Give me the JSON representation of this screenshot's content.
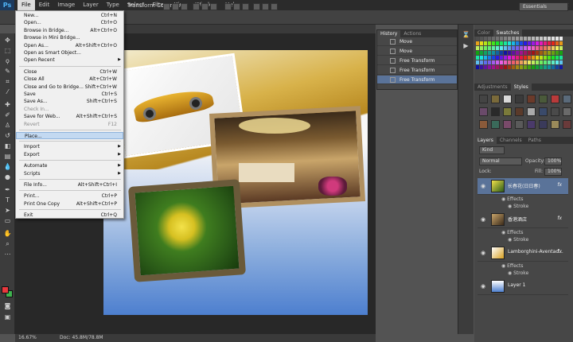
{
  "app": {
    "logo": "Ps"
  },
  "menubar": [
    "File",
    "Edit",
    "Image",
    "Layer",
    "Type",
    "Select",
    "Filter",
    "View",
    "Window",
    "Help"
  ],
  "window_controls": [
    "–",
    "□",
    "✕"
  ],
  "options_bar": {
    "show_transform_controls": "Transform Controls",
    "workspace": "Essentials"
  },
  "file_menu": [
    {
      "label": "New...",
      "shortcut": "Ctrl+N"
    },
    {
      "label": "Open...",
      "shortcut": "Ctrl+O"
    },
    {
      "label": "Browse in Bridge...",
      "shortcut": "Alt+Ctrl+O"
    },
    {
      "label": "Browse in Mini Bridge...",
      "shortcut": ""
    },
    {
      "label": "Open As...",
      "shortcut": "Alt+Shift+Ctrl+O"
    },
    {
      "label": "Open as Smart Object...",
      "shortcut": ""
    },
    {
      "label": "Open Recent",
      "shortcut": "",
      "submenu": true
    },
    {
      "sep": true
    },
    {
      "label": "Close",
      "shortcut": "Ctrl+W"
    },
    {
      "label": "Close All",
      "shortcut": "Alt+Ctrl+W"
    },
    {
      "label": "Close and Go to Bridge...",
      "shortcut": "Shift+Ctrl+W"
    },
    {
      "label": "Save",
      "shortcut": "Ctrl+S"
    },
    {
      "label": "Save As...",
      "shortcut": "Shift+Ctrl+S"
    },
    {
      "label": "Check In...",
      "shortcut": "",
      "disabled": true
    },
    {
      "label": "Save for Web...",
      "shortcut": "Alt+Shift+Ctrl+S"
    },
    {
      "label": "Revert",
      "shortcut": "F12",
      "disabled": true
    },
    {
      "sep": true
    },
    {
      "label": "Place...",
      "shortcut": "",
      "highlighted": true
    },
    {
      "sep": true
    },
    {
      "label": "Import",
      "shortcut": "",
      "submenu": true
    },
    {
      "label": "Export",
      "shortcut": "",
      "submenu": true
    },
    {
      "sep": true
    },
    {
      "label": "Automate",
      "shortcut": "",
      "submenu": true
    },
    {
      "label": "Scripts",
      "shortcut": "",
      "submenu": true
    },
    {
      "sep": true
    },
    {
      "label": "File Info...",
      "shortcut": "Alt+Shift+Ctrl+I"
    },
    {
      "sep": true
    },
    {
      "label": "Print...",
      "shortcut": "Ctrl+P"
    },
    {
      "label": "Print One Copy",
      "shortcut": "Alt+Shift+Ctrl+P"
    },
    {
      "sep": true
    },
    {
      "label": "Exit",
      "shortcut": "Ctrl+Q"
    }
  ],
  "history_panel": {
    "tabs": [
      "History",
      "Actions"
    ],
    "items": [
      {
        "label": "Move"
      },
      {
        "label": "Move"
      },
      {
        "label": "Free Transform"
      },
      {
        "label": "Free Transform"
      },
      {
        "label": "Free Transform",
        "selected": true
      }
    ]
  },
  "color_panel": {
    "tabs": [
      "Color",
      "Swatches"
    ]
  },
  "styles_panel": {
    "tabs": [
      "Adjustments",
      "Styles"
    ]
  },
  "layers_panel": {
    "tabs": [
      "Layers",
      "Channels",
      "Paths"
    ],
    "filter": "Kind",
    "blend_mode": "Normal",
    "opacity_label": "Opacity:",
    "opacity": "100%",
    "lock_label": "Lock:",
    "fill_label": "Fill:",
    "fill": "100%",
    "layers": [
      {
        "name": "长春花(日日春)",
        "fx": "fx",
        "effects": [
          "Effects",
          "Stroke"
        ],
        "selected": true
      },
      {
        "name": "香港酒店",
        "fx": "fx",
        "effects": [
          "Effects",
          "Stroke"
        ]
      },
      {
        "name": "Lamborghini-Aventad...",
        "fx": "fx",
        "effects": [
          "Effects",
          "Stroke"
        ]
      },
      {
        "name": "Layer 1",
        "fx": "",
        "effects": []
      }
    ]
  },
  "status": {
    "zoom": "16.67%",
    "doc": "Doc: 45.8M/78.8M"
  }
}
